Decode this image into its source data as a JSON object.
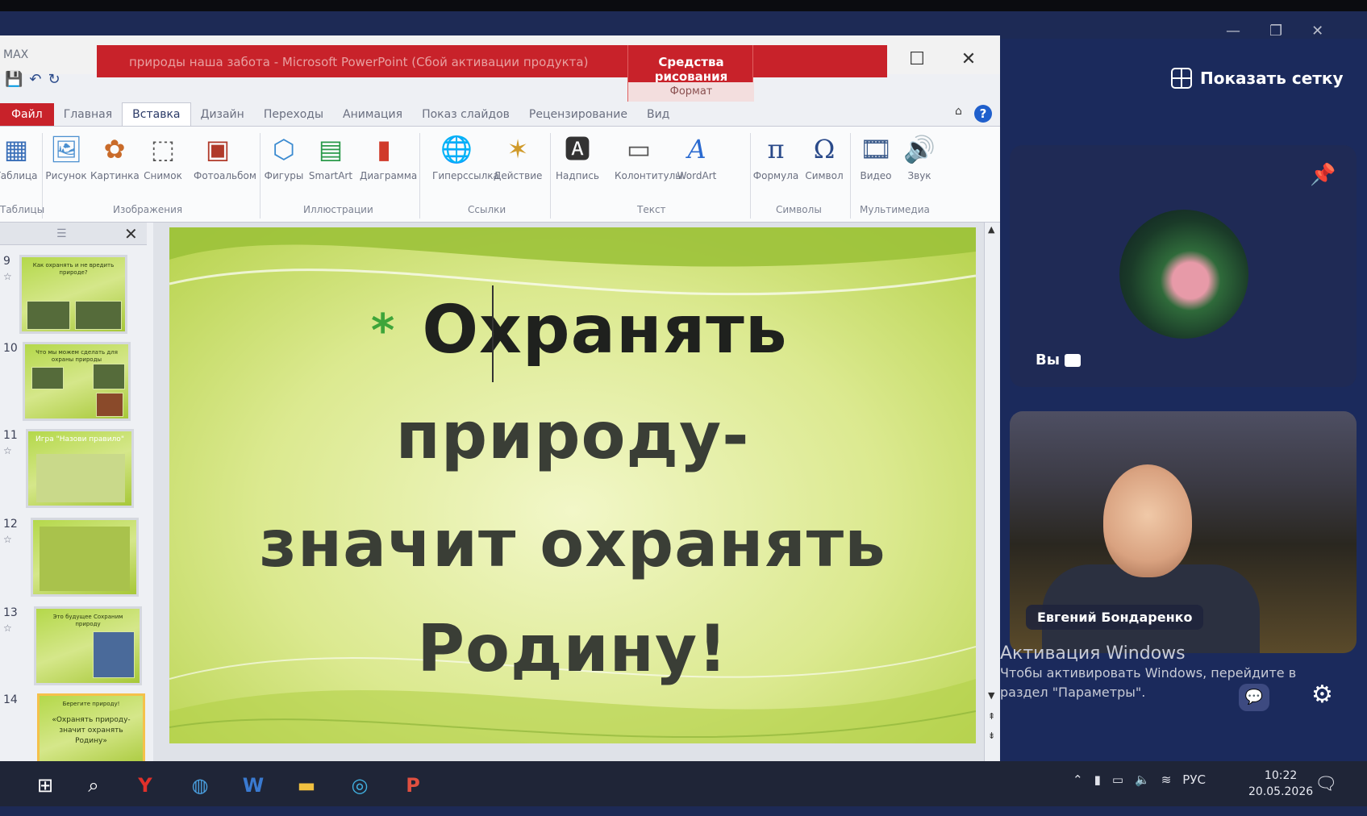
{
  "window": {
    "app_name": "MAX",
    "title": "природы наша забота - Microsoft PowerPoint (Сбой активации продукта)",
    "contextual_tab_group": "Средства рисования",
    "contextual_tab": "Формат"
  },
  "ribbon": {
    "tabs": [
      "Файл",
      "Главная",
      "Вставка",
      "Дизайн",
      "Переходы",
      "Анимация",
      "Показ слайдов",
      "Рецензирование",
      "Вид"
    ],
    "active_tab": "Вставка",
    "buttons": {
      "table": "Таблица",
      "picture": "Рисунок",
      "clipart": "Картинка",
      "screenshot": "Снимок",
      "photoalbum": "Фотоальбом",
      "shapes": "Фигуры",
      "smartart": "SmartArt",
      "chart": "Диаграмма",
      "hyperlink": "Гиперссылка",
      "action": "Действие",
      "textbox": "Надпись",
      "header_footer": "Колонтитулы",
      "wordart": "WordArt",
      "equation": "Формула",
      "symbol": "Символ",
      "video": "Видео",
      "audio": "Звук"
    },
    "groups": {
      "tables": "Таблицы",
      "images": "Изображения",
      "illustrations": "Иллюстрации",
      "links": "Ссылки",
      "text": "Текст",
      "symbols": "Символы",
      "media": "Мультимедиа"
    }
  },
  "thumbnails": [
    {
      "num": "9",
      "title": "Как охранять и не вредить природе?"
    },
    {
      "num": "10",
      "title": "Что мы можем сделать для охраны природы"
    },
    {
      "num": "11",
      "title": "Игра \"Назови правило\""
    },
    {
      "num": "12",
      "title": ""
    },
    {
      "num": "13",
      "title": "Это будущее Сохраним природу"
    },
    {
      "num": "14",
      "title": "Берегите природу!",
      "body": "«Охранять природу- значит охранять Родину»"
    }
  ],
  "slide": {
    "bullet": "*",
    "lines": [
      "Охранять",
      "природу-",
      "значит охранять",
      "Родину!"
    ]
  },
  "meeting": {
    "show_grid": "Показать сетку",
    "self_label": "Вы",
    "participant_name": "Евгений Бондаренко"
  },
  "activation": {
    "title": "Активация Windows",
    "text": "Чтобы активировать Windows, перейдите в раздел \"Параметры\"."
  },
  "taskbar": {
    "language": "РУС",
    "time": "10:22",
    "date": "20.05.2026"
  }
}
